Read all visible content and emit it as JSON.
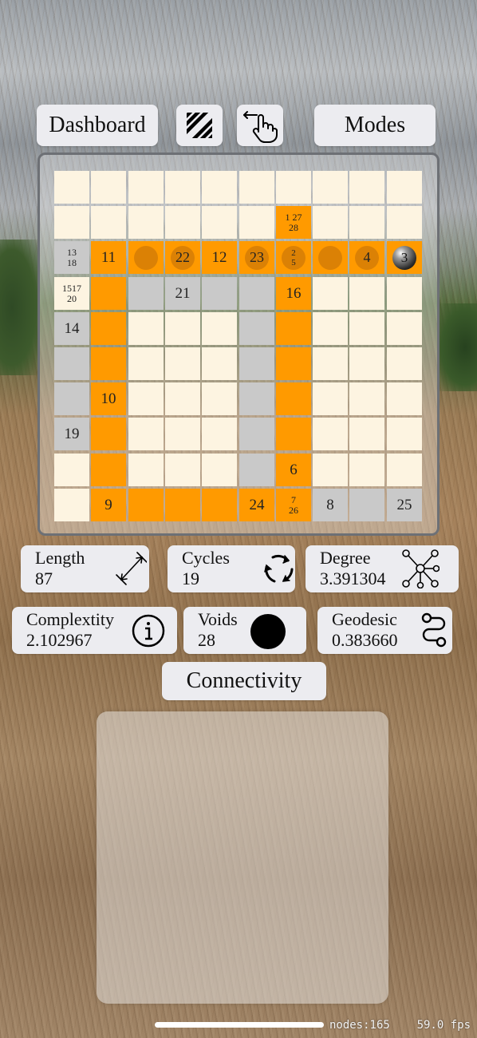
{
  "toolbar": {
    "dashboard_label": "Dashboard",
    "pattern_icon": "diagonal-stripes-icon",
    "swipe_icon": "swipe-hand-icon",
    "modes_label": "Modes"
  },
  "grid": {
    "rows": [
      [
        {
          "t": "c"
        },
        {
          "t": "c"
        },
        {
          "t": "c"
        },
        {
          "t": "c"
        },
        {
          "t": "c"
        },
        {
          "t": "c"
        },
        {
          "t": "c"
        },
        {
          "t": "c"
        },
        {
          "t": "c"
        },
        {
          "t": "c"
        }
      ],
      [
        {
          "t": "c"
        },
        {
          "t": "c"
        },
        {
          "t": "c"
        },
        {
          "t": "c"
        },
        {
          "t": "c"
        },
        {
          "t": "c"
        },
        {
          "t": "o",
          "lines": [
            "1 27",
            "28"
          ]
        },
        {
          "t": "c"
        },
        {
          "t": "c"
        },
        {
          "t": "c"
        }
      ],
      [
        {
          "t": "g",
          "lines": [
            "13",
            "18"
          ]
        },
        {
          "t": "o",
          "text": "11"
        },
        {
          "t": "o",
          "dot": true
        },
        {
          "t": "o",
          "text": "22",
          "dot": true
        },
        {
          "t": "o",
          "text": "12"
        },
        {
          "t": "o",
          "text": "23",
          "dot": true
        },
        {
          "t": "o",
          "lines": [
            "2",
            "5"
          ],
          "dot": true
        },
        {
          "t": "o",
          "dot": true
        },
        {
          "t": "o",
          "text": "4",
          "dot": true
        },
        {
          "t": "o",
          "text": "3",
          "ball": true
        }
      ],
      [
        {
          "t": "c",
          "lines": [
            "1517",
            "20"
          ]
        },
        {
          "t": "o"
        },
        {
          "t": "g"
        },
        {
          "t": "g",
          "text": "21"
        },
        {
          "t": "g"
        },
        {
          "t": "g"
        },
        {
          "t": "o",
          "text": "16"
        },
        {
          "t": "c"
        },
        {
          "t": "c"
        },
        {
          "t": "c"
        }
      ],
      [
        {
          "t": "g",
          "text": "14"
        },
        {
          "t": "o"
        },
        {
          "t": "c"
        },
        {
          "t": "c"
        },
        {
          "t": "c"
        },
        {
          "t": "g"
        },
        {
          "t": "o"
        },
        {
          "t": "c"
        },
        {
          "t": "c"
        },
        {
          "t": "c"
        }
      ],
      [
        {
          "t": "g"
        },
        {
          "t": "o"
        },
        {
          "t": "c"
        },
        {
          "t": "c"
        },
        {
          "t": "c"
        },
        {
          "t": "g"
        },
        {
          "t": "o"
        },
        {
          "t": "c"
        },
        {
          "t": "c"
        },
        {
          "t": "c"
        }
      ],
      [
        {
          "t": "g"
        },
        {
          "t": "o",
          "text": "10"
        },
        {
          "t": "c"
        },
        {
          "t": "c"
        },
        {
          "t": "c"
        },
        {
          "t": "g"
        },
        {
          "t": "o"
        },
        {
          "t": "c"
        },
        {
          "t": "c"
        },
        {
          "t": "c"
        }
      ],
      [
        {
          "t": "g",
          "text": "19"
        },
        {
          "t": "o"
        },
        {
          "t": "c"
        },
        {
          "t": "c"
        },
        {
          "t": "c"
        },
        {
          "t": "g"
        },
        {
          "t": "o"
        },
        {
          "t": "c"
        },
        {
          "t": "c"
        },
        {
          "t": "c"
        }
      ],
      [
        {
          "t": "c"
        },
        {
          "t": "o"
        },
        {
          "t": "c"
        },
        {
          "t": "c"
        },
        {
          "t": "c"
        },
        {
          "t": "g"
        },
        {
          "t": "o",
          "text": "6"
        },
        {
          "t": "c"
        },
        {
          "t": "c"
        },
        {
          "t": "c"
        }
      ],
      [
        {
          "t": "c"
        },
        {
          "t": "o",
          "text": "9"
        },
        {
          "t": "o"
        },
        {
          "t": "o"
        },
        {
          "t": "o"
        },
        {
          "t": "o",
          "text": "24"
        },
        {
          "t": "o",
          "lines": [
            "7",
            "26"
          ]
        },
        {
          "t": "g",
          "text": "8"
        },
        {
          "t": "g"
        },
        {
          "t": "g",
          "text": "25"
        }
      ]
    ]
  },
  "stats": {
    "length": {
      "label": "Length",
      "value": "87",
      "icon": "measure-arrow-icon"
    },
    "cycles": {
      "label": "Cycles",
      "value": "19",
      "icon": "cycle-arrows-icon"
    },
    "degree": {
      "label": "Degree",
      "value": "3.391304",
      "icon": "network-nodes-icon"
    },
    "complexity": {
      "label": "Complextity",
      "value": "2.102967",
      "icon": "info-circle-icon"
    },
    "voids": {
      "label": "Voids",
      "value": "28",
      "icon": "filled-circle-icon"
    },
    "geodesic": {
      "label": "Geodesic",
      "value": "0.383660",
      "icon": "route-path-icon"
    }
  },
  "connectivity_label": "Connectivity",
  "debug": {
    "nodes": "nodes:165",
    "fps": "59.0 fps"
  }
}
